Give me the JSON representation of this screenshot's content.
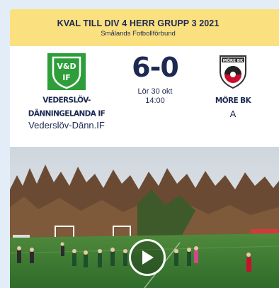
{
  "header": {
    "title": "KVAL TILL DIV 4 HERR GRUPP 3 2021",
    "subtitle": "Smålands Fotbollförbund"
  },
  "match": {
    "home": {
      "name_line1": "VEDERSLÖV-",
      "name_line2": "DÄNNINGELANDA IF",
      "short": "Vederslöv-Dänn.IF",
      "logo_text": "V&D IF",
      "logo_icon": "shield-crest-green"
    },
    "away": {
      "name": "MÖRE BK",
      "team": "A",
      "logo_text": "MÖRE BK",
      "logo_icon": "shield-crest-red-black"
    },
    "score": "6-0",
    "date": "Lör 30 okt",
    "time": "14:00"
  },
  "video": {
    "play_icon": "play-icon"
  },
  "colors": {
    "header_bg": "#fbe07f",
    "text_navy": "#1c2a52",
    "page_bg": "#e3edf7",
    "home_green": "#2e9e3a",
    "away_red": "#c8102e"
  }
}
